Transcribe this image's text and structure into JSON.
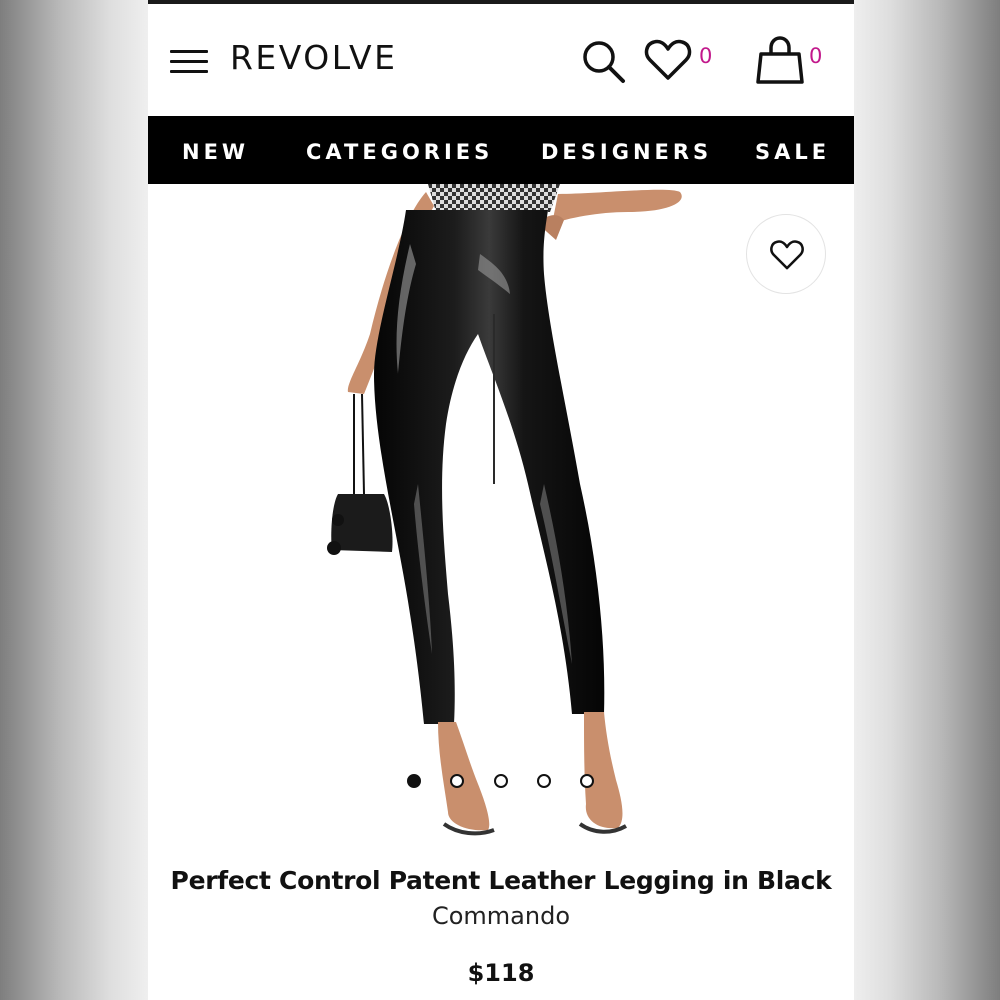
{
  "header": {
    "logo": "REVOLVE",
    "wishlist_count": "0",
    "bag_count": "0",
    "accent_color": "#c2188b"
  },
  "nav": {
    "items": [
      "NEW",
      "CATEGORIES",
      "DESIGNERS",
      "SALE"
    ]
  },
  "gallery": {
    "total_images": 5,
    "active_index": 0
  },
  "product": {
    "title": "Perfect Control Patent Leather Legging in Black",
    "brand": "Commando",
    "price": "$118"
  }
}
